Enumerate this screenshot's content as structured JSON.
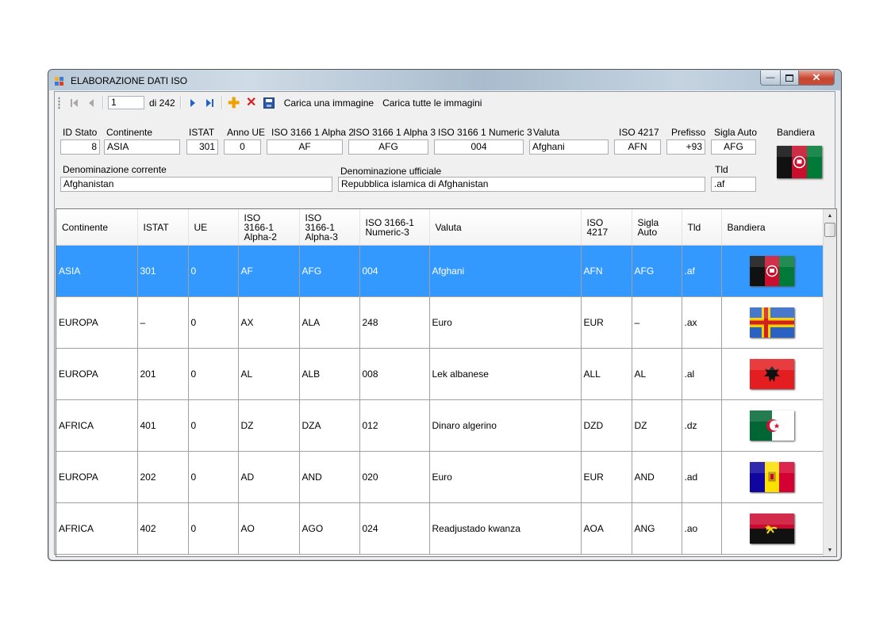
{
  "window": {
    "title": "ELABORAZIONE DATI ISO"
  },
  "toolbar": {
    "position": "1",
    "of_label": "di 242",
    "load_image": "Carica una immagine",
    "load_all_images": "Carica tutte le immagini"
  },
  "form": {
    "labels": {
      "id_stato": "ID Stato",
      "continente": "Continente",
      "istat": "ISTAT",
      "anno_ue": "Anno UE",
      "alpha2": "ISO 3166 1 Alpha 2",
      "alpha3": "ISO 3166 1 Alpha 3",
      "numeric3": "ISO 3166 1 Numeric 3",
      "valuta": "Valuta",
      "iso4217": "ISO 4217",
      "prefisso": "Prefisso",
      "sigla_auto": "Sigla Auto",
      "bandiera": "Bandiera",
      "den_corrente": "Denominazione corrente",
      "den_ufficiale": "Denominazione ufficiale",
      "tld": "Tld"
    },
    "values": {
      "id_stato": "8",
      "continente": "ASIA",
      "istat": "301",
      "anno_ue": "0",
      "alpha2": "AF",
      "alpha3": "AFG",
      "numeric3": "004",
      "valuta": "Afghani",
      "iso4217": "AFN",
      "prefisso": "+93",
      "sigla_auto": "AFG",
      "den_corrente": "Afghanistan",
      "den_ufficiale": "Repubblica islamica di Afghanistan",
      "tld": ".af"
    },
    "flag": "afghanistan-flag"
  },
  "grid": {
    "headers": {
      "continente": "Continente",
      "istat": "ISTAT",
      "ue": "UE",
      "alpha2_1": "ISO",
      "alpha2_2": "3166-1",
      "alpha2_3": "Alpha-2",
      "alpha3_1": "ISO",
      "alpha3_2": "3166-1",
      "alpha3_3": "Alpha-3",
      "numeric_1": "ISO 3166-1",
      "numeric_2": "Numeric-3",
      "valuta": "Valuta",
      "iso_1": "ISO",
      "iso_2": "4217",
      "sigla_1": "Sigla",
      "sigla_2": "Auto",
      "tld": "Tld",
      "bandiera": "Bandiera"
    },
    "rows": [
      {
        "continente": "ASIA",
        "istat": "301",
        "ue": "0",
        "a2": "AF",
        "a3": "AFG",
        "num": "004",
        "valuta": "Afghani",
        "iso": "AFN",
        "sigla": "AFG",
        "tld": ".af",
        "flag": "afghanistan-flag",
        "selected": true
      },
      {
        "continente": "EUROPA",
        "istat": "–",
        "ue": "0",
        "a2": "AX",
        "a3": "ALA",
        "num": "248",
        "valuta": "Euro",
        "iso": "EUR",
        "sigla": "–",
        "tld": ".ax",
        "flag": "aland-flag",
        "selected": false
      },
      {
        "continente": "EUROPA",
        "istat": "201",
        "ue": "0",
        "a2": "AL",
        "a3": "ALB",
        "num": "008",
        "valuta": "Lek albanese",
        "iso": "ALL",
        "sigla": "AL",
        "tld": ".al",
        "flag": "albania-flag",
        "selected": false
      },
      {
        "continente": "AFRICA",
        "istat": "401",
        "ue": "0",
        "a2": "DZ",
        "a3": "DZA",
        "num": "012",
        "valuta": "Dinaro algerino",
        "iso": "DZD",
        "sigla": "DZ",
        "tld": ".dz",
        "flag": "algeria-flag",
        "selected": false
      },
      {
        "continente": "EUROPA",
        "istat": "202",
        "ue": "0",
        "a2": "AD",
        "a3": "AND",
        "num": "020",
        "valuta": "Euro",
        "iso": "EUR",
        "sigla": "AND",
        "tld": ".ad",
        "flag": "andorra-flag",
        "selected": false
      },
      {
        "continente": "AFRICA",
        "istat": "402",
        "ue": "0",
        "a2": "AO",
        "a3": "AGO",
        "num": "024",
        "valuta": "Readjustado kwanza",
        "iso": "AOA",
        "sigla": "ANG",
        "tld": ".ao",
        "flag": "angola-flag",
        "selected": false
      }
    ]
  },
  "colors": {
    "selection": "#3399ff",
    "nav_blue": "#1f64c9",
    "delete_red": "#d42020",
    "add_orange": "#f0a000"
  }
}
